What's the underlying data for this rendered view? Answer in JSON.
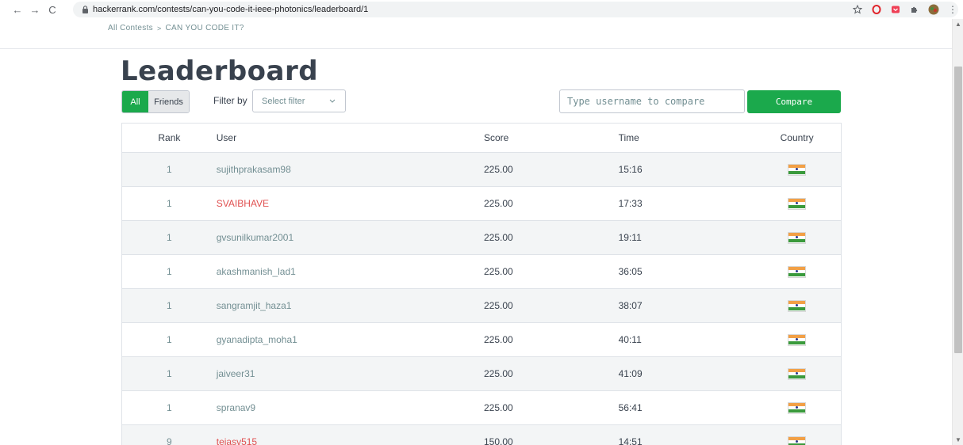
{
  "browser": {
    "url": "hackerrank.com/contests/can-you-code-it-ieee-photonics/leaderboard/1",
    "back_glyph": "←",
    "forward_glyph": "→",
    "reload_glyph": "C",
    "menu_glyph": "⋮"
  },
  "breadcrumb": {
    "root": "All Contests",
    "separator": ">",
    "current": "CAN YOU CODE IT?"
  },
  "page": {
    "title": "Leaderboard"
  },
  "controls": {
    "filter_all": "All",
    "filter_friends": "Friends",
    "filter_by_label": "Filter by",
    "select_filter_placeholder": "Select filter",
    "compare_placeholder": "Type username to compare",
    "compare_button": "Compare"
  },
  "table": {
    "headers": {
      "rank": "Rank",
      "user": "User",
      "score": "Score",
      "time": "Time",
      "country": "Country"
    },
    "rows": [
      {
        "rank": "1",
        "user": "sujithprakasam98",
        "score": "225.00",
        "time": "15:16",
        "country": "india-flag",
        "highlight": false
      },
      {
        "rank": "1",
        "user": "SVAIBHAVE",
        "score": "225.00",
        "time": "17:33",
        "country": "india-flag",
        "highlight": true
      },
      {
        "rank": "1",
        "user": "gvsunilkumar2001",
        "score": "225.00",
        "time": "19:11",
        "country": "india-flag",
        "highlight": false
      },
      {
        "rank": "1",
        "user": "akashmanish_lad1",
        "score": "225.00",
        "time": "36:05",
        "country": "india-flag",
        "highlight": false
      },
      {
        "rank": "1",
        "user": "sangramjit_haza1",
        "score": "225.00",
        "time": "38:07",
        "country": "india-flag",
        "highlight": false
      },
      {
        "rank": "1",
        "user": "gyanadipta_moha1",
        "score": "225.00",
        "time": "40:11",
        "country": "india-flag",
        "highlight": false
      },
      {
        "rank": "1",
        "user": "jaiveer31",
        "score": "225.00",
        "time": "41:09",
        "country": "india-flag",
        "highlight": false
      },
      {
        "rank": "1",
        "user": "spranav9",
        "score": "225.00",
        "time": "56:41",
        "country": "india-flag",
        "highlight": false
      },
      {
        "rank": "9",
        "user": "tejasv515",
        "score": "150.00",
        "time": "14:51",
        "country": "india-flag",
        "highlight": true
      }
    ]
  },
  "colors": {
    "accent_green": "#1ba94c",
    "highlight_red": "#e05050",
    "text_dark": "#39424e",
    "text_muted": "#738f93"
  }
}
